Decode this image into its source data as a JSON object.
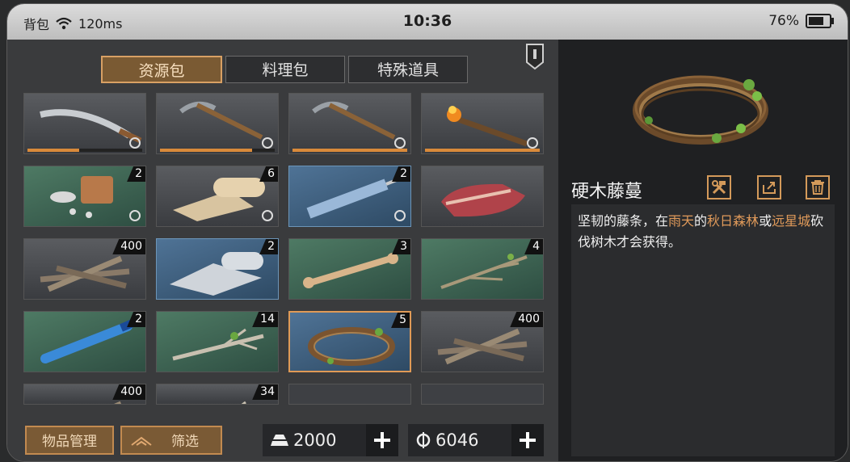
{
  "status": {
    "app": "背包",
    "ping": "120ms",
    "time": "10:36",
    "battery": "76%",
    "battery_level": 0.76
  },
  "tabs": [
    {
      "label": "资源包",
      "active": true
    },
    {
      "label": "料理包",
      "active": false
    },
    {
      "label": "特殊道具",
      "active": false
    }
  ],
  "items": [
    {
      "name": "machete-icon",
      "count": "",
      "durability": 0.45,
      "badge": true
    },
    {
      "name": "pickaxe-icon",
      "count": "",
      "durability": 0.8,
      "badge": true
    },
    {
      "name": "pickaxe-icon",
      "count": "",
      "durability": 1.0,
      "badge": true
    },
    {
      "name": "torch-icon",
      "count": "",
      "durability": 1.0,
      "badge": true
    },
    {
      "name": "pill-jar-icon",
      "count": "2",
      "badge": true
    },
    {
      "name": "cloth-roll-icon",
      "count": "6",
      "badge": true
    },
    {
      "name": "syringe-icon",
      "count": "2",
      "badge": true
    },
    {
      "name": "meat-icon",
      "count": "",
      "badge": false
    },
    {
      "name": "firewood-icon",
      "count": "400",
      "badge": false
    },
    {
      "name": "paper-roll-icon",
      "count": "2",
      "badge": false
    },
    {
      "name": "bone-icon",
      "count": "3",
      "badge": false
    },
    {
      "name": "twig-icon",
      "count": "4",
      "badge": false
    },
    {
      "name": "test-tube-icon",
      "count": "2",
      "badge": false
    },
    {
      "name": "branch-icon",
      "count": "14",
      "badge": false
    },
    {
      "name": "vine-wreath-icon",
      "count": "5",
      "badge": false
    },
    {
      "name": "firewood-icon",
      "count": "400",
      "badge": false
    },
    {
      "name": "firewood-icon",
      "count": "400",
      "badge": false
    },
    {
      "name": "branch-icon",
      "count": "34",
      "badge": false
    },
    {
      "name": "empty",
      "count": ""
    },
    {
      "name": "empty",
      "count": ""
    }
  ],
  "bottom": {
    "manage": "物品管理",
    "filter": "筛选",
    "gold": "2000",
    "coins": "6046"
  },
  "detail": {
    "title": "硬木藤蔓",
    "desc_parts": [
      "坚韧的藤条，在",
      "雨天",
      "的",
      "秋日森林",
      "或",
      "远星城",
      "砍伐树木才会获得。"
    ]
  },
  "colors": {
    "accent": "#d8a064",
    "green_cell": "#4e7a64",
    "blue_cell": "#4f7396",
    "highlight": "#e09a5a"
  }
}
